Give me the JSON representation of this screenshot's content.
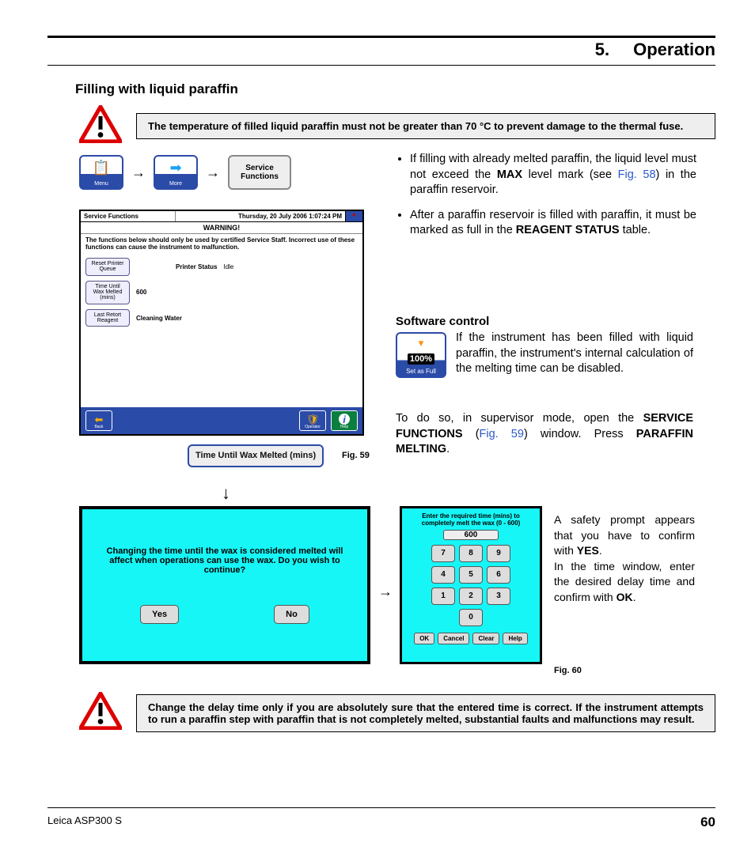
{
  "header": {
    "num": "5.",
    "title": "Operation"
  },
  "section": "Filling with liquid paraffin",
  "warning1": "The temperature of filled liquid paraffin must not be greater than 70 °C to prevent damage to the thermal fuse.",
  "nav": {
    "menu": "Menu",
    "more": "More",
    "svc": "Service Functions",
    "b1": "📋",
    "b2": "➡"
  },
  "bullets": {
    "b1a": "If filling with already melted paraffin, the liquid level must not exceed the ",
    "b1b": "MAX",
    "b1c": " level mark (see ",
    "b1d": "Fig. 58",
    "b1e": ") in the paraffin reservoir.",
    "b2a": "After a paraffin reservoir is filled with paraffin, it must be marked as full in the ",
    "b2b": "REAGENT STATUS",
    "b2c": " table."
  },
  "screenshot": {
    "title": "Service Functions",
    "date": "Thursday, 20 July 2006 1:07:24 PM",
    "warn": "WARNING!",
    "note": "The functions below should only be used by certified Service Staff. Incorrect use of these functions can cause the instrument to malfunction.",
    "btn1": "Reset Printer Queue",
    "ps_label": "Printer Status",
    "ps_val": "Idle",
    "btn2": "Time Until Wax Melted (mins)",
    "val2": "600",
    "btn3": "Last Retort Reagent",
    "val3": "Cleaning Water",
    "back": "Back",
    "oper": "Operator",
    "help": "Help"
  },
  "fig59": "Fig. 59",
  "timebtn": "Time Until Wax Melted (mins)",
  "softTitle": "Software control",
  "setfull": {
    "pct": "100%",
    "label": "Set as Full"
  },
  "softText": "If the instrument has been filled with liquid paraffin, the instrument's internal calculation of the melting time can be disabled.",
  "softText2a": "To do so, in supervisor mode, open the ",
  "softText2b": "SERVICE FUNCTIONS",
  "softText2c": " (",
  "softText2d": "Fig. 59",
  "softText2e": ") window. Press ",
  "softText2f": "PARAFFIN MELTING",
  "softText2g": ".",
  "prompt": {
    "msg": "Changing the time until the wax is considered melted will affect when operations can use the wax. Do you wish to continue?",
    "yes": "Yes",
    "no": "No"
  },
  "numpad": {
    "hd": "Enter the required time (mins) to completely melt the wax (0 - 600)",
    "disp": "600",
    "keys": [
      "7",
      "8",
      "9",
      "4",
      "5",
      "6",
      "1",
      "2",
      "3"
    ],
    "zero": "0",
    "ok": "OK",
    "cancel": "Cancel",
    "clear": "Clear",
    "help": "Help"
  },
  "right": {
    "p1a": "A safety prompt appears that you have to confirm with ",
    "p1b": "YES",
    "p1c": ".",
    "p2a": "In the time window, enter the desired delay time and confirm with ",
    "p2b": "OK",
    "p2c": "."
  },
  "fig60": "Fig. 60",
  "warning2": "Change the delay time only if you are absolutely sure that the entered time is correct.\nIf the instrument attempts to run a paraffin step with paraffin that is not completely melted, substantial faults and malfunctions may result.",
  "footer": {
    "prod": "Leica ASP300 S",
    "page": "60"
  }
}
